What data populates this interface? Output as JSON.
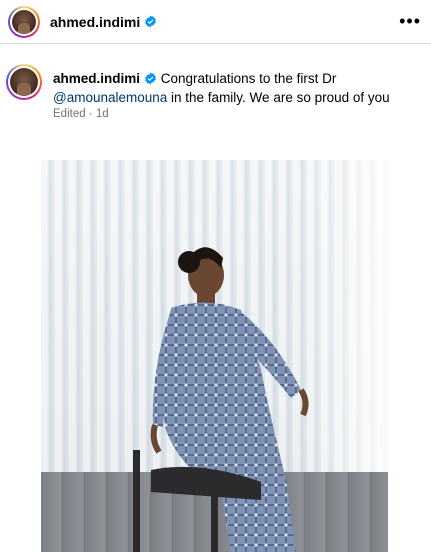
{
  "header": {
    "username": "ahmed.indimi",
    "more_label": "•••"
  },
  "comment": {
    "username": "ahmed.indimi",
    "text_before": "Congratulations to the first Dr ",
    "mention": "@amounalemouna",
    "text_after": " in the family. We are so proud of you",
    "meta": "Edited · 1d"
  },
  "icons": {
    "verified": "verified-badge-icon",
    "more": "more-options-icon"
  },
  "colors": {
    "verified_blue": "#0095f6",
    "mention": "#00376b",
    "meta_gray": "#737373"
  }
}
